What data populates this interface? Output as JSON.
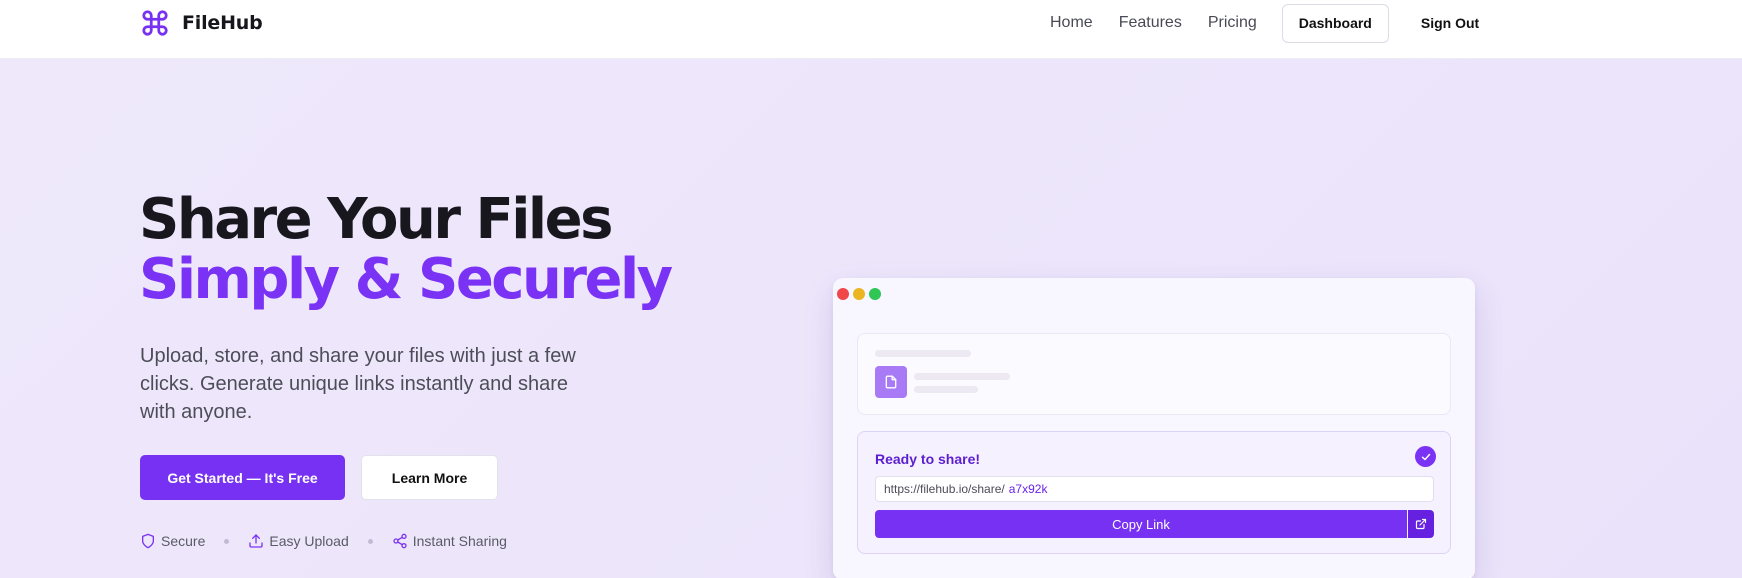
{
  "brand": {
    "name": "FileHub",
    "icon": "command-icon"
  },
  "nav": {
    "links": [
      "Home",
      "Features",
      "Pricing"
    ],
    "dashboard_label": "Dashboard",
    "signout_label": "Sign Out"
  },
  "hero": {
    "title_line1": "Share Your Files",
    "title_line2": "Simply & Securely",
    "subtitle": "Upload, store, and share your files with just a few clicks. Generate unique links instantly and share with anyone.",
    "cta_primary": "Get Started — It's Free",
    "cta_secondary": "Learn More",
    "features": [
      {
        "label": "Secure",
        "icon": "shield-icon"
      },
      {
        "label": "Easy Upload",
        "icon": "upload-icon"
      },
      {
        "label": "Instant Sharing",
        "icon": "share-icon"
      }
    ]
  },
  "mock": {
    "ready_label": "Ready to share!",
    "url_prefix": "https://filehub.io/share/",
    "url_code": "a7x92k",
    "copy_label": "Copy Link"
  },
  "colors": {
    "accent": "#7731f3",
    "accent_text": "#7a33f5",
    "hero_bg": "#eee7fb"
  }
}
